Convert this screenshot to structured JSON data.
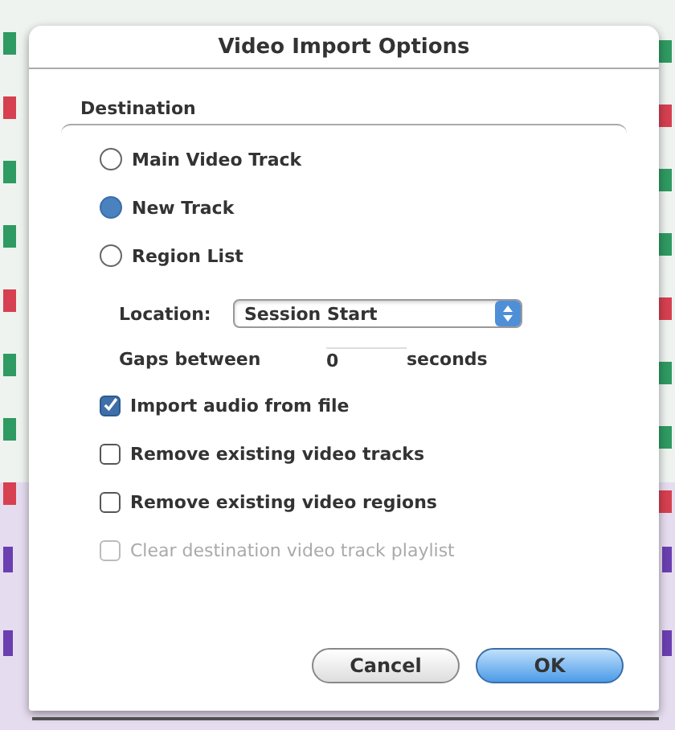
{
  "window": {
    "title": "Video Import Options"
  },
  "destination": {
    "label": "Destination",
    "options": [
      {
        "label": "Main Video Track",
        "selected": false
      },
      {
        "label": "New Track",
        "selected": true
      },
      {
        "label": "Region List",
        "selected": false
      }
    ]
  },
  "location": {
    "label": "Location:",
    "value": "Session Start"
  },
  "gaps": {
    "label": "Gaps between",
    "value": "0",
    "unit": "seconds"
  },
  "checkboxes": [
    {
      "label": "Import audio from file",
      "checked": true,
      "disabled": false
    },
    {
      "label": "Remove existing video tracks",
      "checked": false,
      "disabled": false
    },
    {
      "label": "Remove existing video regions",
      "checked": false,
      "disabled": false
    },
    {
      "label": "Clear destination video track playlist",
      "checked": false,
      "disabled": true
    }
  ],
  "buttons": [
    {
      "label": "Cancel",
      "default": false
    },
    {
      "label": "OK",
      "default": true
    }
  ]
}
